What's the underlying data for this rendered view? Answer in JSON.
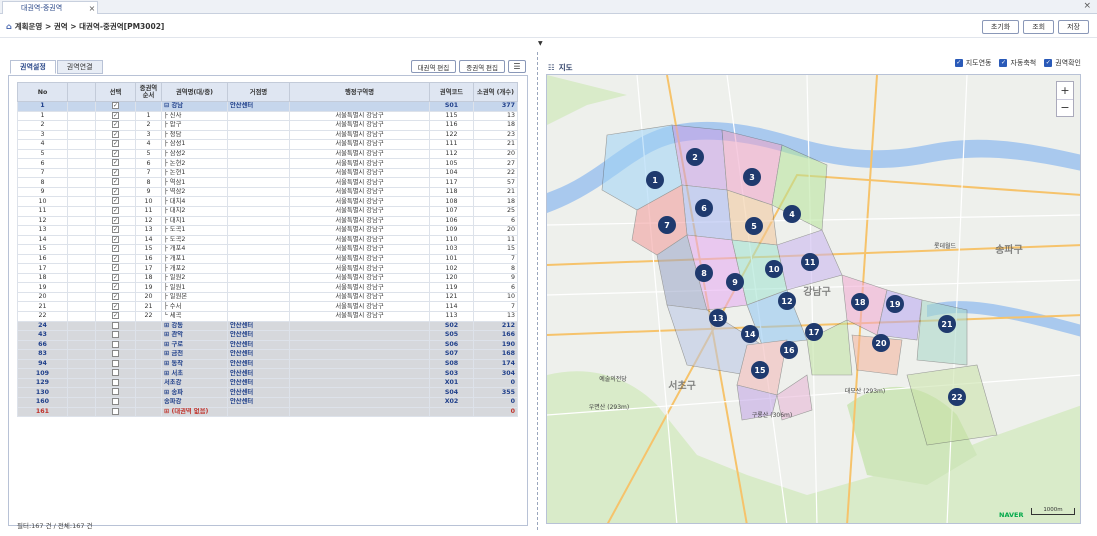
{
  "tab": {
    "title": "대권역-중권역"
  },
  "breadcrumb": {
    "text": "계획운영 > 권역 > 대권역-중권역[PM3002]"
  },
  "toolbar": {
    "reset_label": "초기화",
    "search_label": "조회",
    "save_label": "저장"
  },
  "left": {
    "tabs": [
      "권역설정",
      "권역연결"
    ],
    "btn_big": "대권역 편집",
    "btn_mid": "중권역 편집",
    "headers": [
      "No",
      "선택",
      "중권역 순서",
      "권역명(대/중)",
      "거점명",
      "행정구역명",
      "권역코드",
      "소권역 (개수)"
    ],
    "rows": [
      {
        "no": "1",
        "sel": "✓",
        "ord": "",
        "name": "⊟ 강남",
        "hub": "안산센터",
        "addr": "",
        "code": "S01",
        "cnt": "377",
        "type": "first"
      },
      {
        "no": "1",
        "sel": "✓",
        "ord": "1",
        "name": "├ 신사",
        "hub": "",
        "addr": "서울특별시 강남구",
        "code": "115",
        "cnt": "13",
        "type": "sub"
      },
      {
        "no": "2",
        "sel": "✓",
        "ord": "2",
        "name": "├ 압구",
        "hub": "",
        "addr": "서울특별시 강남구",
        "code": "116",
        "cnt": "18",
        "type": "sub"
      },
      {
        "no": "3",
        "sel": "✓",
        "ord": "3",
        "name": "├ 청담",
        "hub": "",
        "addr": "서울특별시 강남구",
        "code": "122",
        "cnt": "23",
        "type": "sub"
      },
      {
        "no": "4",
        "sel": "✓",
        "ord": "4",
        "name": "├ 삼성1",
        "hub": "",
        "addr": "서울특별시 강남구",
        "code": "111",
        "cnt": "21",
        "type": "sub"
      },
      {
        "no": "5",
        "sel": "✓",
        "ord": "5",
        "name": "├ 삼성2",
        "hub": "",
        "addr": "서울특별시 강남구",
        "code": "112",
        "cnt": "20",
        "type": "sub"
      },
      {
        "no": "6",
        "sel": "✓",
        "ord": "6",
        "name": "├ 논현2",
        "hub": "",
        "addr": "서울특별시 강남구",
        "code": "105",
        "cnt": "27",
        "type": "sub"
      },
      {
        "no": "7",
        "sel": "✓",
        "ord": "7",
        "name": "├ 논현1",
        "hub": "",
        "addr": "서울특별시 강남구",
        "code": "104",
        "cnt": "22",
        "type": "sub"
      },
      {
        "no": "8",
        "sel": "✓",
        "ord": "8",
        "name": "├ 역삼1",
        "hub": "",
        "addr": "서울특별시 강남구",
        "code": "117",
        "cnt": "57",
        "type": "sub"
      },
      {
        "no": "9",
        "sel": "✓",
        "ord": "9",
        "name": "├ 역삼2",
        "hub": "",
        "addr": "서울특별시 강남구",
        "code": "118",
        "cnt": "21",
        "type": "sub"
      },
      {
        "no": "10",
        "sel": "✓",
        "ord": "10",
        "name": "├ 대치4",
        "hub": "",
        "addr": "서울특별시 강남구",
        "code": "108",
        "cnt": "18",
        "type": "sub"
      },
      {
        "no": "11",
        "sel": "✓",
        "ord": "11",
        "name": "├ 대치2",
        "hub": "",
        "addr": "서울특별시 강남구",
        "code": "107",
        "cnt": "25",
        "type": "sub"
      },
      {
        "no": "12",
        "sel": "✓",
        "ord": "12",
        "name": "├ 대치1",
        "hub": "",
        "addr": "서울특별시 강남구",
        "code": "106",
        "cnt": "6",
        "type": "sub"
      },
      {
        "no": "13",
        "sel": "✓",
        "ord": "13",
        "name": "├ 도곡1",
        "hub": "",
        "addr": "서울특별시 강남구",
        "code": "109",
        "cnt": "20",
        "type": "sub"
      },
      {
        "no": "14",
        "sel": "✓",
        "ord": "14",
        "name": "├ 도곡2",
        "hub": "",
        "addr": "서울특별시 강남구",
        "code": "110",
        "cnt": "11",
        "type": "sub"
      },
      {
        "no": "15",
        "sel": "✓",
        "ord": "15",
        "name": "├ 개포4",
        "hub": "",
        "addr": "서울특별시 강남구",
        "code": "103",
        "cnt": "15",
        "type": "sub"
      },
      {
        "no": "16",
        "sel": "✓",
        "ord": "16",
        "name": "├ 개포1",
        "hub": "",
        "addr": "서울특별시 강남구",
        "code": "101",
        "cnt": "7",
        "type": "sub"
      },
      {
        "no": "17",
        "sel": "✓",
        "ord": "17",
        "name": "├ 개포2",
        "hub": "",
        "addr": "서울특별시 강남구",
        "code": "102",
        "cnt": "8",
        "type": "sub"
      },
      {
        "no": "18",
        "sel": "✓",
        "ord": "18",
        "name": "├ 일원2",
        "hub": "",
        "addr": "서울특별시 강남구",
        "code": "120",
        "cnt": "9",
        "type": "sub"
      },
      {
        "no": "19",
        "sel": "✓",
        "ord": "19",
        "name": "├ 일원1",
        "hub": "",
        "addr": "서울특별시 강남구",
        "code": "119",
        "cnt": "6",
        "type": "sub"
      },
      {
        "no": "20",
        "sel": "✓",
        "ord": "20",
        "name": "├ 일원본",
        "hub": "",
        "addr": "서울특별시 강남구",
        "code": "121",
        "cnt": "10",
        "type": "sub"
      },
      {
        "no": "21",
        "sel": "✓",
        "ord": "21",
        "name": "├ 수서",
        "hub": "",
        "addr": "서울특별시 강남구",
        "code": "114",
        "cnt": "7",
        "type": "sub"
      },
      {
        "no": "22",
        "sel": "✓",
        "ord": "22",
        "name": "└ 세곡",
        "hub": "",
        "addr": "서울특별시 강남구",
        "code": "113",
        "cnt": "13",
        "type": "sub"
      },
      {
        "no": "24",
        "sel": "",
        "ord": "",
        "name": "⊞ 강동",
        "hub": "안산센터",
        "addr": "",
        "code": "S02",
        "cnt": "212",
        "type": "grp"
      },
      {
        "no": "43",
        "sel": "",
        "ord": "",
        "name": "⊞ 관악",
        "hub": "안산센터",
        "addr": "",
        "code": "S05",
        "cnt": "166",
        "type": "grp"
      },
      {
        "no": "66",
        "sel": "",
        "ord": "",
        "name": "⊞ 구로",
        "hub": "안산센터",
        "addr": "",
        "code": "S06",
        "cnt": "190",
        "type": "grp"
      },
      {
        "no": "83",
        "sel": "",
        "ord": "",
        "name": "⊞ 금천",
        "hub": "안산센터",
        "addr": "",
        "code": "S07",
        "cnt": "168",
        "type": "grp"
      },
      {
        "no": "94",
        "sel": "",
        "ord": "",
        "name": "⊞ 동작",
        "hub": "안산센터",
        "addr": "",
        "code": "S08",
        "cnt": "174",
        "type": "grp"
      },
      {
        "no": "109",
        "sel": "",
        "ord": "",
        "name": "⊞ 서초",
        "hub": "안산센터",
        "addr": "",
        "code": "S03",
        "cnt": "304",
        "type": "grp"
      },
      {
        "no": "129",
        "sel": "",
        "ord": "",
        "name": "  서초강",
        "hub": "안산센터",
        "addr": "",
        "code": "X01",
        "cnt": "0",
        "type": "grp"
      },
      {
        "no": "130",
        "sel": "",
        "ord": "",
        "name": "⊞ 송파",
        "hub": "안산센터",
        "addr": "",
        "code": "S04",
        "cnt": "355",
        "type": "grp"
      },
      {
        "no": "160",
        "sel": "",
        "ord": "",
        "name": "  송파강",
        "hub": "안산센터",
        "addr": "",
        "code": "X02",
        "cnt": "0",
        "type": "grp"
      },
      {
        "no": "161",
        "sel": "",
        "ord": "",
        "name": "⊞ (대권역 없음)",
        "hub": "",
        "addr": "",
        "code": "",
        "cnt": "0",
        "type": "none"
      }
    ],
    "status": "필터:167 건 / 전체:167 건"
  },
  "right": {
    "title": "지도",
    "checks": [
      "지도연동",
      "자동축척",
      "권역확인"
    ],
    "map_labels": [
      "강남구",
      "서초구",
      "송파구",
      "롯데월드",
      "예술의전당",
      "우면산 (293m)",
      "구룡산 (306m)",
      "대모산 (293m)"
    ],
    "markers": [
      "1",
      "2",
      "3",
      "4",
      "5",
      "6",
      "7",
      "8",
      "9",
      "10",
      "11",
      "12",
      "13",
      "14",
      "15",
      "16",
      "17",
      "18",
      "19",
      "20",
      "21",
      "22"
    ],
    "scale_label": "1000m",
    "brand": "NAVER",
    "colors": {
      "primary": "#2c4a8a",
      "marker": "#1f3a6e",
      "river": "#a9c9ee"
    }
  }
}
